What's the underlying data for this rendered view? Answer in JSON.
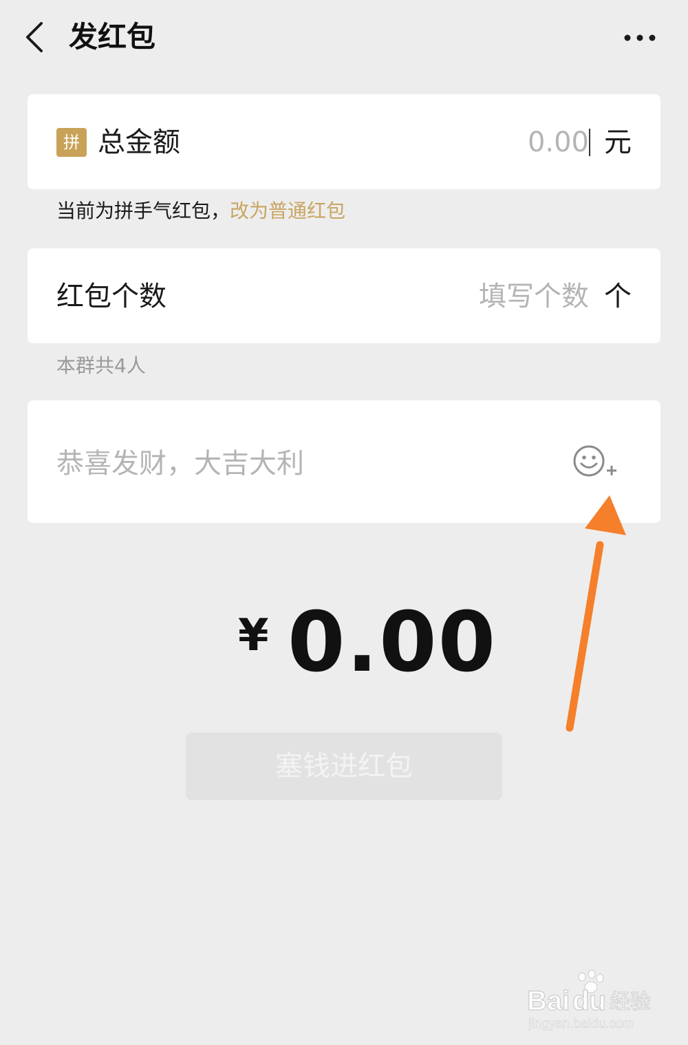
{
  "header": {
    "title": "发红包",
    "back_icon": "chevron-left-icon",
    "more_icon": "more-horizontal-icon"
  },
  "amount_card": {
    "badge": "拼",
    "label": "总金额",
    "value": "0.00",
    "unit": "元"
  },
  "mode_hint": {
    "text": "当前为拼手气红包，",
    "link": "改为普通红包"
  },
  "count_card": {
    "label": "红包个数",
    "placeholder": "填写个数",
    "unit": "个"
  },
  "member_note": "本群共4人",
  "message_card": {
    "placeholder": "恭喜发财，大吉大利",
    "emoji_icon": "emoji-add-icon"
  },
  "total": {
    "currency": "¥",
    "value": "0.00"
  },
  "submit": {
    "label": "塞钱进红包",
    "enabled": false
  },
  "annotation": {
    "arrow_color": "#f57f2a"
  },
  "watermark": {
    "brand": "Bai",
    "brand_suffix": "经验",
    "url": "jingyan.baidu.com"
  },
  "colors": {
    "accent_gold": "#c9a561",
    "badge_gold": "#c8a258",
    "background": "#ededed"
  }
}
